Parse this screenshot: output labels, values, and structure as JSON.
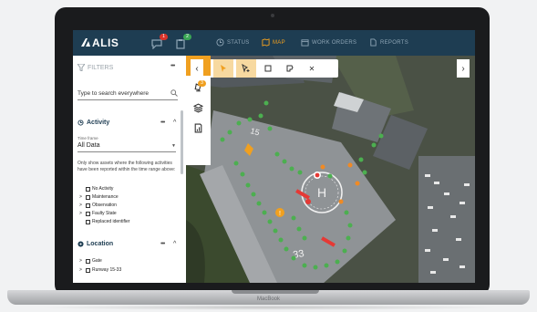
{
  "device": {
    "brand": "MacBook"
  },
  "app": {
    "logo": "ALIS",
    "notifications": [
      {
        "icon": "chat-icon",
        "count": "1",
        "color": "#d9342b"
      },
      {
        "icon": "clipboard-icon",
        "count": "2",
        "color": "#3aa655"
      }
    ],
    "nav": [
      {
        "label": "STATUS",
        "icon": "clock-icon",
        "active": false
      },
      {
        "label": "MAP",
        "icon": "map-icon",
        "active": true
      },
      {
        "label": "WORK ORDERS",
        "icon": "calendar-icon",
        "active": false
      },
      {
        "label": "REPORTS",
        "icon": "document-icon",
        "active": false
      }
    ]
  },
  "filters": {
    "title": "FILTERS",
    "search_placeholder": "Type to search everywhere",
    "activity": {
      "title": "Activity",
      "time_frame_label": "Time frame",
      "time_frame_value": "All Data",
      "description": "Only show assets where the following activities have been reported within the time range above:",
      "options": [
        {
          "label": "No Activity",
          "expandable": false
        },
        {
          "label": "Maintenance",
          "expandable": true
        },
        {
          "label": "Observation",
          "expandable": true
        },
        {
          "label": "Faulty State",
          "expandable": true
        },
        {
          "label": "Replaced identifier",
          "expandable": false
        }
      ]
    },
    "location": {
      "title": "Location",
      "options": [
        {
          "label": "Gate",
          "expandable": true
        },
        {
          "label": "Runway 15-33",
          "expandable": true
        }
      ]
    }
  },
  "map": {
    "tools": [
      "filter-icon",
      "lamp-icon",
      "layers-icon",
      "report-icon"
    ],
    "tool_badge": "3",
    "toolbar": [
      "select-cursor-icon",
      "add-cursor-icon",
      "box-select-icon",
      "lasso-select-icon",
      "close-icon"
    ],
    "runway_labels": [
      "15",
      "33"
    ],
    "helipad_label": "H",
    "colors": {
      "ok": "#4caf50",
      "warning": "#f08a24",
      "fault": "#e53935",
      "accent": "#f0a020"
    }
  }
}
